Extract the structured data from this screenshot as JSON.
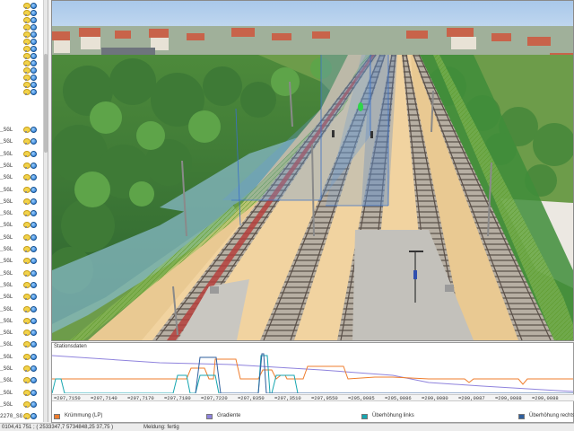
{
  "tree": {
    "items": [
      {
        "label": ""
      },
      {
        "label": ""
      },
      {
        "label": ""
      },
      {
        "label": ""
      },
      {
        "label": ""
      },
      {
        "label": ""
      },
      {
        "label": ""
      },
      {
        "label": ""
      },
      {
        "label": ""
      },
      {
        "label": ""
      },
      {
        "label": ""
      },
      {
        "label": ""
      },
      {
        "label": ""
      },
      {
        "label": "_SGL"
      },
      {
        "label": "_SGL"
      },
      {
        "label": "_SGL"
      },
      {
        "label": "_SGL"
      },
      {
        "label": "_SGL"
      },
      {
        "label": "_SGL"
      },
      {
        "label": "_SGL"
      },
      {
        "label": "_SGL"
      },
      {
        "label": "_SGL"
      },
      {
        "label": "_SGL"
      },
      {
        "label": "_SGL"
      },
      {
        "label": "_SGL"
      },
      {
        "label": "_SGL"
      },
      {
        "label": "_SGL"
      },
      {
        "label": "_SGL"
      },
      {
        "label": "_SGL"
      },
      {
        "label": "_SGL"
      },
      {
        "label": "_SGL"
      },
      {
        "label": "_SGL"
      },
      {
        "label": "_SGL"
      },
      {
        "label": "_SGL"
      },
      {
        "label": "_SGL"
      },
      {
        "label": "_SGL"
      },
      {
        "label": "_SGL"
      },
      {
        "label": "2270_SG"
      }
    ]
  },
  "panel": {
    "title": "Stationsdaten",
    "stations": [
      "=297,7150",
      "=297,7140",
      "=297,7170",
      "=297,7180",
      "=297,7220",
      "=297,9350",
      "=297,3510",
      "=297,9550",
      "=295,0985",
      "=295,0086",
      "=299,0080",
      "=299,0087",
      "=299,0088",
      "=299,0088"
    ],
    "legend": [
      {
        "label": "Krümmung (LP)",
        "color": "#ef7d2d"
      },
      {
        "label": "Gradiente",
        "color": "#8f83dd"
      },
      {
        "label": "Überhöhung links",
        "color": "#17a6b0"
      },
      {
        "label": "Überhöhung rechts",
        "color": "#2f5f9e"
      }
    ]
  },
  "status": {
    "coords": "0104,41 751 ; ( 2533347,7 5734848,25 37,75 )",
    "message": "Meldung: fertig"
  },
  "colors": {
    "curvature": "#ef7d2d",
    "gradient": "#8f83dd",
    "cant_left": "#17a6b0",
    "cant_right": "#2f5f9e",
    "sky": "#bcd6ef",
    "platform": "#f0c98c"
  }
}
